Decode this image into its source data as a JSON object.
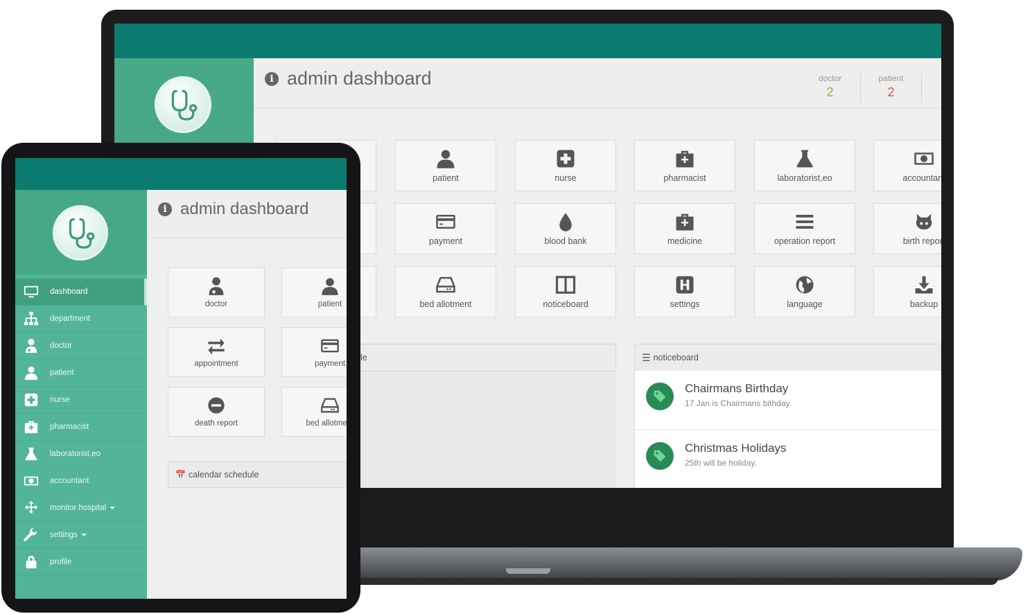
{
  "laptop": {
    "title": "admin dashboard",
    "stats": [
      {
        "label": "doctor",
        "value": "2",
        "color": "#8ab34a"
      },
      {
        "label": "patient",
        "value": "2",
        "color": "#d9534f"
      }
    ],
    "tiles": [
      {
        "label": "patient",
        "icon": "user-icon"
      },
      {
        "label": "nurse",
        "icon": "plus-square-icon"
      },
      {
        "label": "pharmacist",
        "icon": "medkit-icon"
      },
      {
        "label": "laboratorist,eo",
        "icon": "flask-icon"
      },
      {
        "label": "accountant",
        "icon": "money-icon"
      },
      {
        "label": "payment",
        "icon": "credit-card-icon"
      },
      {
        "label": "blood bank",
        "icon": "tint-icon"
      },
      {
        "label": "medicine",
        "icon": "medkit-icon"
      },
      {
        "label": "operation report",
        "icon": "bars-icon"
      },
      {
        "label": "birth report",
        "icon": "github-icon"
      },
      {
        "label": "bed allotment",
        "icon": "hdd-icon"
      },
      {
        "label": "noticeboard",
        "icon": "columns-icon"
      },
      {
        "label": "settings",
        "icon": "h-square-icon"
      },
      {
        "label": "language",
        "icon": "globe-icon"
      },
      {
        "label": "backup",
        "icon": "download-icon"
      }
    ],
    "calendar_suffix": "le",
    "noticeboard": {
      "title": "noticeboard",
      "items": [
        {
          "title": "Chairmans Birthday",
          "desc": "17 Jan is Chairmans bithday."
        },
        {
          "title": "Christmas Holidays",
          "desc": "25th will be holiday."
        }
      ]
    }
  },
  "tablet": {
    "title": "admin dashboard",
    "nav": [
      {
        "label": "dashboard",
        "icon": "desktop-icon",
        "active": true
      },
      {
        "label": "department",
        "icon": "sitemap-icon"
      },
      {
        "label": "doctor",
        "icon": "user-md-icon"
      },
      {
        "label": "patient",
        "icon": "user-icon"
      },
      {
        "label": "nurse",
        "icon": "plus-square-icon"
      },
      {
        "label": "pharmacist",
        "icon": "medkit-icon"
      },
      {
        "label": "laboratorist,eo",
        "icon": "flask-icon"
      },
      {
        "label": "accountant",
        "icon": "money-icon"
      },
      {
        "label": "monitor hospital",
        "icon": "arrows-icon",
        "dropdown": true
      },
      {
        "label": "settings",
        "icon": "wrench-icon",
        "dropdown": true
      },
      {
        "label": "profile",
        "icon": "lock-icon"
      }
    ],
    "tiles": [
      {
        "label": "doctor",
        "icon": "user-md-icon"
      },
      {
        "label": "patient",
        "icon": "user-icon"
      },
      {
        "label": "appointment",
        "icon": "exchange-icon"
      },
      {
        "label": "payment",
        "icon": "credit-card-icon"
      },
      {
        "label": "death report",
        "icon": "minus-circle-icon"
      },
      {
        "label": "bed allotment",
        "icon": "hdd-icon"
      }
    ],
    "calendar_title": "calendar schedule"
  },
  "colors": {
    "topbar": "#0a7b6e",
    "sidebar": "#52b597",
    "tag": "#2a8a55"
  }
}
